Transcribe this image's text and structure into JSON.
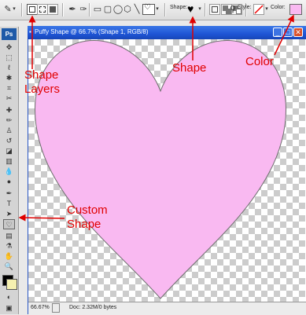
{
  "options_bar": {
    "shape_label": "Shape:",
    "style_label": "Style:",
    "color_label": "Color:",
    "tool_icon": "custom-shape-tool-icon",
    "mode_buttons": [
      "shape-layers-icon",
      "paths-icon",
      "fill-pixels-icon"
    ],
    "shape_buttons": [
      "pen-icon",
      "freeform-pen-icon",
      "rectangle-icon",
      "rounded-rectangle-icon",
      "ellipse-icon",
      "polygon-icon",
      "line-icon",
      "custom-shape-icon"
    ],
    "selected_shape": "heart",
    "color_swatch": "#f9b9f1"
  },
  "toolbox": {
    "logo": "Ps",
    "foreground_color": "#000000",
    "background_color": "#f5f0b0"
  },
  "document": {
    "title": "Puffy Shape @ 66.7% (Shape 1, RGB/8)",
    "zoom": "66.67%",
    "doc_size": "Doc: 2.32M/0 bytes",
    "heart_color": "#f9b9f1"
  },
  "annotations": {
    "shape_layers_line1": "Shape",
    "shape_layers_line2": "Layers",
    "shape": "Shape",
    "color": "Color",
    "custom_shape_line1": "Custom",
    "custom_shape_line2": "Shape",
    "arrow_color": "#e00000"
  }
}
